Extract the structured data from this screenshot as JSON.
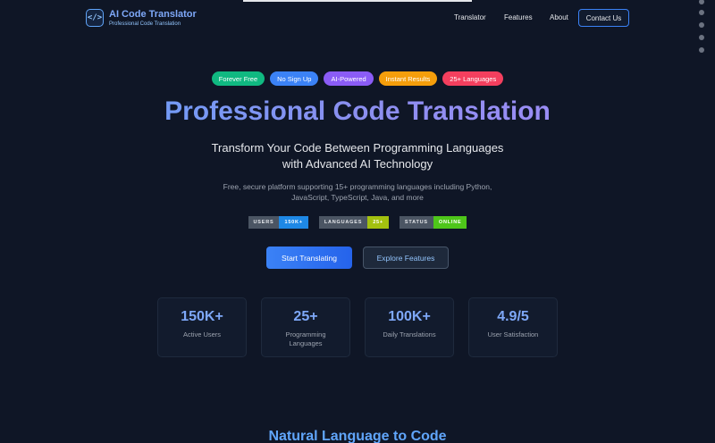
{
  "header": {
    "logo_glyph": "</>",
    "brand_title": "AI Code Translator",
    "brand_subtitle": "Professional Code Translation",
    "nav": [
      "Translator",
      "Features",
      "About"
    ],
    "contact_label": "Contact Us"
  },
  "badges": [
    {
      "label": "Forever Free",
      "color": "#10b981"
    },
    {
      "label": "No Sign Up",
      "color": "#3b82f6"
    },
    {
      "label": "AI-Powered",
      "color": "#8b5cf6"
    },
    {
      "label": "Instant Results",
      "color": "#f59e0b"
    },
    {
      "label": "25+ Languages",
      "color": "#f43f5e"
    }
  ],
  "hero": {
    "title": "Professional Code Translation",
    "subtitle_line1": "Transform Your Code Between Programming Languages",
    "subtitle_line2": "with Advanced AI Technology",
    "desc_line1": "Free, secure platform supporting 15+ programming languages including Python,",
    "desc_line2": "JavaScript, TypeScript, Java, and more"
  },
  "shields": [
    {
      "key": "USERS",
      "value": "150K+",
      "color": "#1e88e5"
    },
    {
      "key": "LANGUAGES",
      "value": "25+",
      "color": "#a3c10f"
    },
    {
      "key": "STATUS",
      "value": "ONLINE",
      "color": "#4ec61a"
    }
  ],
  "cta": {
    "primary": "Start Translating",
    "secondary": "Explore Features"
  },
  "stats": [
    {
      "value": "150K+",
      "label": "Active Users"
    },
    {
      "value": "25+",
      "label": "Programming Languages"
    },
    {
      "value": "100K+",
      "label": "Daily Translations"
    },
    {
      "value": "4.9/5",
      "label": "User Satisfaction"
    }
  ],
  "next_section_title": "Natural Language to Code"
}
